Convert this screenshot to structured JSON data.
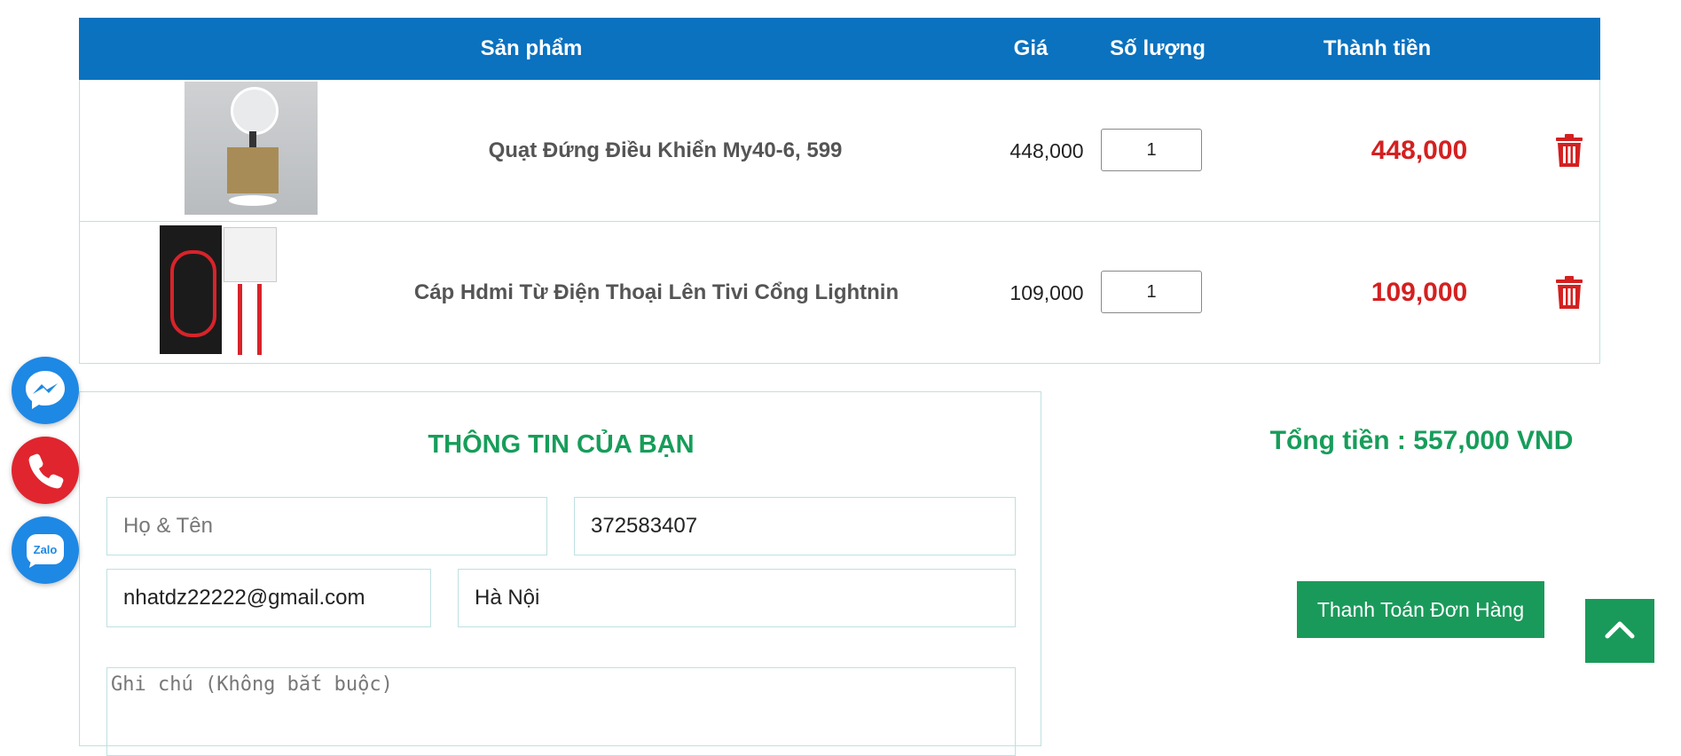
{
  "cart": {
    "headers": {
      "product": "Sản phẩm",
      "price": "Giá",
      "quantity": "Số lượng",
      "total": "Thành tiền"
    },
    "items": [
      {
        "name": "Quạt Đứng Điều Khiển My40-6, 599",
        "price": "448,000",
        "quantity": "1",
        "total": "448,000"
      },
      {
        "name": "Cáp Hdmi Từ Điện Thoại Lên Tivi Cổng Lightnin",
        "price": "109,000",
        "quantity": "1",
        "total": "109,000"
      }
    ]
  },
  "info": {
    "title": "THÔNG TIN CỦA BẠN",
    "name_placeholder": "Họ & Tên",
    "phone_value": "372583407",
    "email_value": "nhatdz22222@gmail.com",
    "address_value": "Hà Nội",
    "note_placeholder": "Ghi chú (Không bắt buộc)"
  },
  "summary": {
    "grand_total": "Tổng tiền : 557,000 VND",
    "checkout_label": "Thanh Toán Đơn Hàng"
  },
  "icons": {
    "messenger": "messenger-icon",
    "phone": "phone-icon",
    "zalo": "zalo-icon",
    "zalo_label": "Zalo",
    "trash": "trash-icon",
    "back_to_top": "chevron-up-icon"
  },
  "colors": {
    "header_blue": "#0a72bf",
    "accent_green": "#179d5a",
    "price_red": "#d42020"
  }
}
